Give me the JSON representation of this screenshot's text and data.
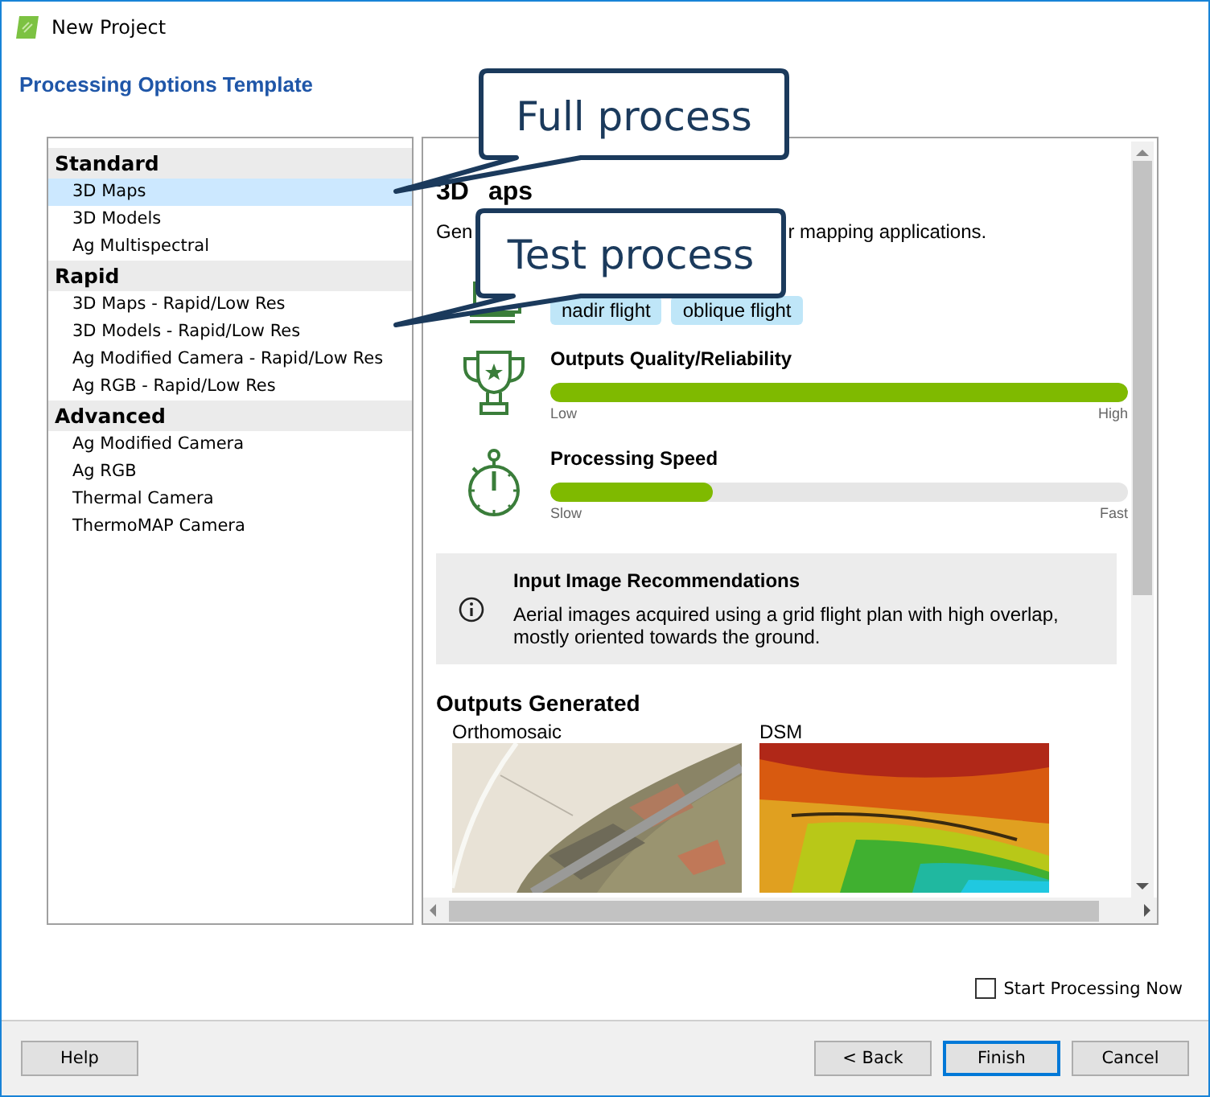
{
  "window": {
    "title": "New Project"
  },
  "heading": "Processing Options Template",
  "sidebar": {
    "groups": [
      {
        "label": "Standard",
        "items": [
          {
            "label": "3D Maps",
            "selected": true
          },
          {
            "label": "3D Models",
            "selected": false
          },
          {
            "label": "Ag Multispectral",
            "selected": false
          }
        ]
      },
      {
        "label": "Rapid",
        "items": [
          {
            "label": "3D Maps - Rapid/Low Res",
            "selected": false
          },
          {
            "label": "3D Models - Rapid/Low Res",
            "selected": false
          },
          {
            "label": "Ag Modified Camera - Rapid/Low Res",
            "selected": false
          },
          {
            "label": "Ag RGB - Rapid/Low Res",
            "selected": false
          }
        ]
      },
      {
        "label": "Advanced",
        "items": [
          {
            "label": "Ag Modified Camera",
            "selected": false
          },
          {
            "label": "Ag RGB",
            "selected": false
          },
          {
            "label": "Thermal Camera",
            "selected": false
          },
          {
            "label": "ThermoMAP Camera",
            "selected": false
          }
        ]
      }
    ]
  },
  "details": {
    "title_parts": [
      "3D",
      "aps"
    ],
    "description_parts": [
      "Gen",
      "r mapping applications."
    ],
    "tags": [
      "nadir flight",
      "oblique flight"
    ],
    "meters": [
      {
        "label": "Outputs Quality/Reliability",
        "level": 1.0,
        "low": "Low",
        "high": "High",
        "kind": "trophy"
      },
      {
        "label": "Processing Speed",
        "level": 0.28,
        "low": "Slow",
        "high": "Fast",
        "kind": "stopwatch"
      }
    ],
    "recommendation": {
      "title": "Input Image Recommendations",
      "text": "Aerial images acquired using a grid flight plan with high overlap, mostly oriented towards the ground."
    },
    "outputs_heading": "Outputs Generated",
    "outputs": [
      {
        "label": "Orthomosaic",
        "kind": "aerial"
      },
      {
        "label": "DSM",
        "kind": "elevation"
      }
    ]
  },
  "callouts": [
    {
      "text": "Full process"
    },
    {
      "text": "Test process"
    }
  ],
  "start_processing": {
    "label": "Start Processing Now",
    "checked": false
  },
  "buttons": [
    {
      "label": "Help",
      "default": false,
      "kind": "left"
    },
    {
      "label": "< Back",
      "default": false,
      "kind": "right"
    },
    {
      "label": "Finish",
      "default": true,
      "kind": "right"
    },
    {
      "label": "Cancel",
      "default": false,
      "kind": "right"
    }
  ]
}
